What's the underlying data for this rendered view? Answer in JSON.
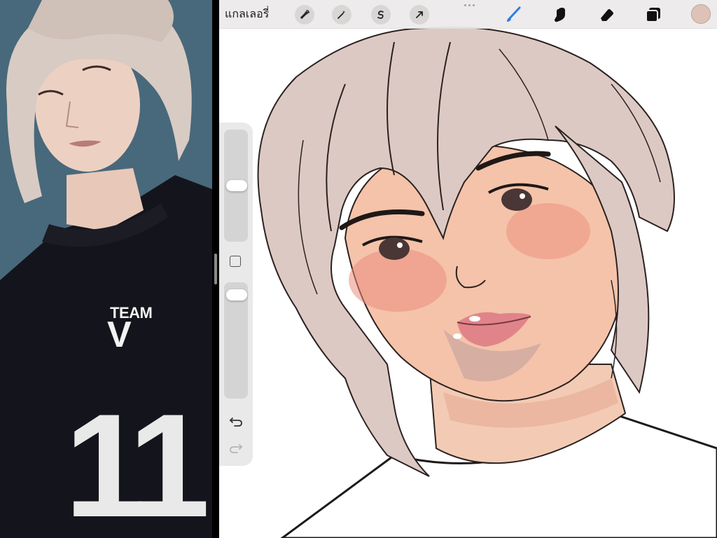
{
  "toolbar": {
    "gallery_label": "แกลเลอรี่",
    "tools_left": [
      {
        "name": "actions",
        "icon": "wrench-icon"
      },
      {
        "name": "adjustments",
        "icon": "magic-wand-icon"
      },
      {
        "name": "selection",
        "icon": "selection-s-icon"
      },
      {
        "name": "transform",
        "icon": "arrow-cursor-icon"
      }
    ],
    "tools_right": [
      {
        "name": "brush",
        "icon": "brush-icon",
        "active": true
      },
      {
        "name": "smudge",
        "icon": "smudge-finger-icon",
        "active": false
      },
      {
        "name": "eraser",
        "icon": "eraser-icon",
        "active": false
      },
      {
        "name": "layers",
        "icon": "layers-icon",
        "active": false
      }
    ],
    "current_color": "#dec2b8",
    "active_tool_color": "#2f7de1"
  },
  "sidebar": {
    "brush_size_level": 0.5,
    "brush_opacity_level": 0.95,
    "buttons": [
      "modify-square-icon",
      "undo-icon",
      "redo-icon"
    ]
  },
  "reference_photo": {
    "shirt_text_top": "TEAM",
    "shirt_text_logo": "V",
    "shirt_number": "11"
  },
  "colors": {
    "hair": "#ddc9c4",
    "skin": "#f0b9a0",
    "blush": "#e9897a",
    "line": "#2a2220",
    "shirt_photo": "#12131a",
    "photo_bg": "#3f6275"
  }
}
